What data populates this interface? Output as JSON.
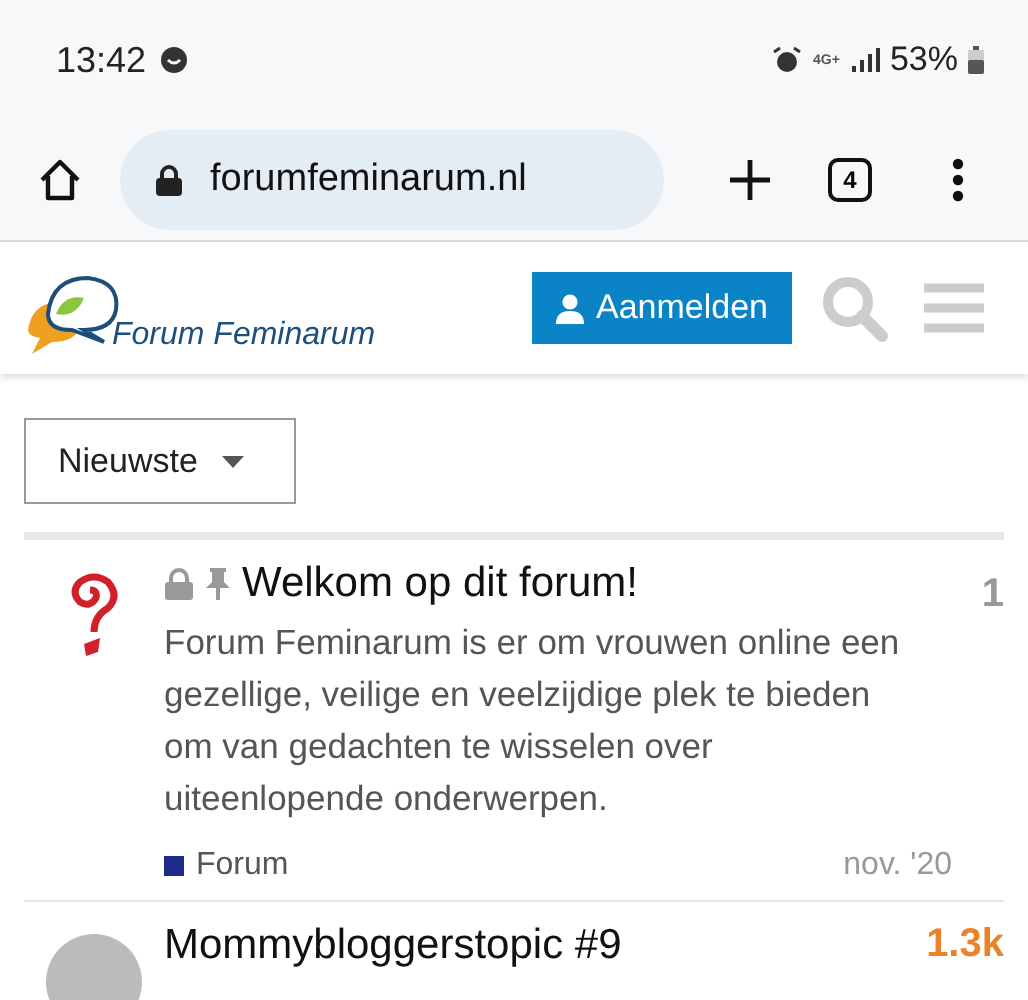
{
  "status_bar": {
    "time": "13:42",
    "network": "4G+",
    "battery": "53%"
  },
  "browser": {
    "url": "forumfeminarum.nl",
    "tab_count": "4"
  },
  "site_header": {
    "logo_text": "Forum Feminarum",
    "login_button": "Aanmelden"
  },
  "filter": {
    "label": "Nieuwste"
  },
  "topics": [
    {
      "title": "Welkom op dit forum!",
      "locked": true,
      "pinned": true,
      "excerpt": "Forum Feminarum is er om vrouwen online een gezellige, veilige en veelzijdige plek te bieden om van gedachten te wisselen over uiteenlopende onderwerpen.",
      "category": "Forum",
      "color": "#1c2a8a",
      "replies": "1",
      "hot": false,
      "date": "nov. '20"
    },
    {
      "title": "Mommybloggerstopic #9",
      "locked": false,
      "pinned": false,
      "replies": "1.3k",
      "hot": true
    }
  ]
}
